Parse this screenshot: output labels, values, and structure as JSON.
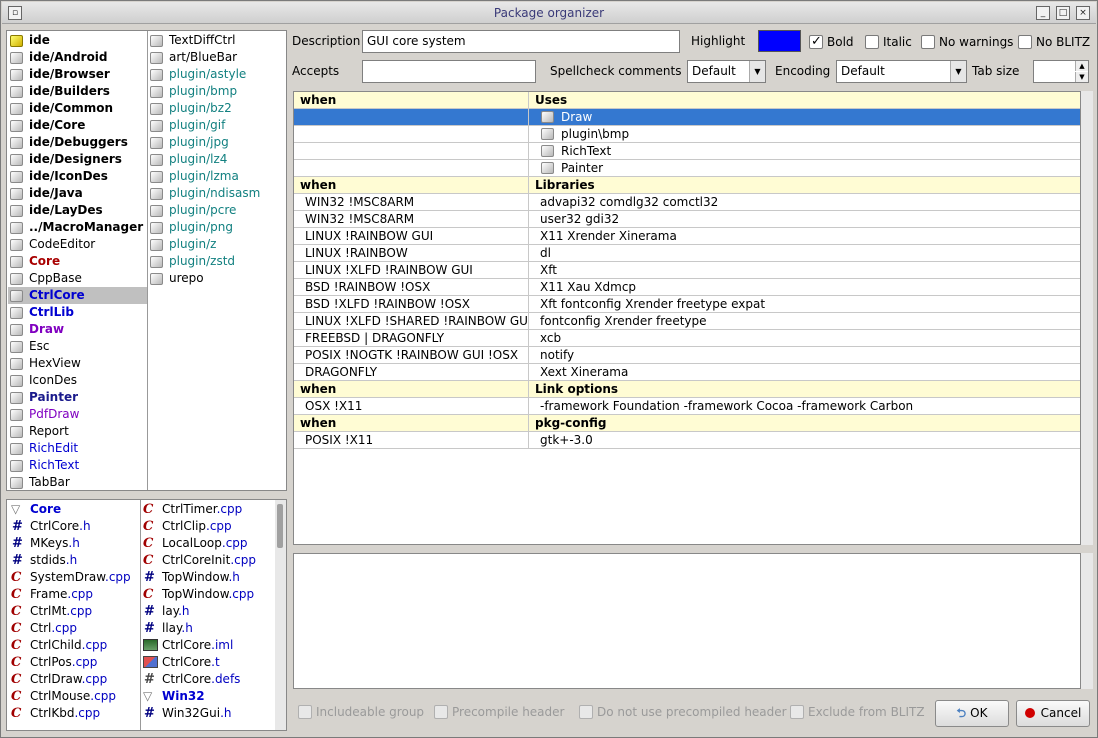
{
  "window": {
    "title": "Package organizer"
  },
  "packages_col1": [
    {
      "label": "ide",
      "cls": "bold",
      "icon": "yellow-package-icon"
    },
    {
      "label": "ide/Android",
      "cls": "bold",
      "icon": "package-icon"
    },
    {
      "label": "ide/Browser",
      "cls": "bold",
      "icon": "package-icon"
    },
    {
      "label": "ide/Builders",
      "cls": "bold",
      "icon": "package-icon"
    },
    {
      "label": "ide/Common",
      "cls": "bold",
      "icon": "package-icon"
    },
    {
      "label": "ide/Core",
      "cls": "bold",
      "icon": "package-icon"
    },
    {
      "label": "ide/Debuggers",
      "cls": "bold",
      "icon": "package-icon"
    },
    {
      "label": "ide/Designers",
      "cls": "bold",
      "icon": "package-icon"
    },
    {
      "label": "ide/IconDes",
      "cls": "bold",
      "icon": "package-icon"
    },
    {
      "label": "ide/Java",
      "cls": "bold",
      "icon": "package-icon"
    },
    {
      "label": "ide/LayDes",
      "cls": "bold",
      "icon": "package-icon"
    },
    {
      "label": "../MacroManager",
      "cls": "bold",
      "icon": "package-icon"
    },
    {
      "label": "CodeEditor",
      "cls": "",
      "icon": "package-icon"
    },
    {
      "label": "Core",
      "cls": "bold red",
      "icon": "package-icon"
    },
    {
      "label": "CppBase",
      "cls": "",
      "icon": "package-icon"
    },
    {
      "label": "CtrlCore",
      "cls": "bold blue sel",
      "icon": "package-icon"
    },
    {
      "label": "CtrlLib",
      "cls": "bold blue",
      "icon": "package-icon"
    },
    {
      "label": "Draw",
      "cls": "bold purple",
      "icon": "package-icon"
    },
    {
      "label": "Esc",
      "cls": "",
      "icon": "package-icon"
    },
    {
      "label": "HexView",
      "cls": "",
      "icon": "package-icon"
    },
    {
      "label": "IconDes",
      "cls": "",
      "icon": "package-icon"
    },
    {
      "label": "Painter",
      "cls": "bold navy",
      "icon": "package-icon"
    },
    {
      "label": "PdfDraw",
      "cls": "purple",
      "icon": "package-icon"
    },
    {
      "label": "Report",
      "cls": "",
      "icon": "package-icon"
    },
    {
      "label": "RichEdit",
      "cls": "blue",
      "icon": "package-icon"
    },
    {
      "label": "RichText",
      "cls": "blue",
      "icon": "package-icon"
    },
    {
      "label": "TabBar",
      "cls": "",
      "icon": "package-icon"
    }
  ],
  "packages_col2": [
    {
      "label": "TextDiffCtrl",
      "cls": ""
    },
    {
      "label": "art/BlueBar",
      "cls": ""
    },
    {
      "label": "plugin/astyle",
      "cls": "teal"
    },
    {
      "label": "plugin/bmp",
      "cls": "teal"
    },
    {
      "label": "plugin/bz2",
      "cls": "teal"
    },
    {
      "label": "plugin/gif",
      "cls": "teal"
    },
    {
      "label": "plugin/jpg",
      "cls": "teal"
    },
    {
      "label": "plugin/lz4",
      "cls": "teal"
    },
    {
      "label": "plugin/lzma",
      "cls": "teal"
    },
    {
      "label": "plugin/ndisasm",
      "cls": "teal"
    },
    {
      "label": "plugin/pcre",
      "cls": "teal"
    },
    {
      "label": "plugin/png",
      "cls": "teal"
    },
    {
      "label": "plugin/z",
      "cls": "teal"
    },
    {
      "label": "plugin/zstd",
      "cls": "teal"
    },
    {
      "label": "urepo",
      "cls": ""
    }
  ],
  "files_col1": [
    {
      "name": "Core",
      "ext": "",
      "kind": "group"
    },
    {
      "name": "CtrlCore",
      "ext": ".h",
      "kind": "header"
    },
    {
      "name": "MKeys",
      "ext": ".h",
      "kind": "header"
    },
    {
      "name": "stdids",
      "ext": ".h",
      "kind": "header"
    },
    {
      "name": "SystemDraw",
      "ext": ".cpp",
      "kind": "cpp"
    },
    {
      "name": "Frame",
      "ext": ".cpp",
      "kind": "cpp"
    },
    {
      "name": "CtrlMt",
      "ext": ".cpp",
      "kind": "cpp"
    },
    {
      "name": "Ctrl",
      "ext": ".cpp",
      "kind": "cpp"
    },
    {
      "name": "CtrlChild",
      "ext": ".cpp",
      "kind": "cpp"
    },
    {
      "name": "CtrlPos",
      "ext": ".cpp",
      "kind": "cpp"
    },
    {
      "name": "CtrlDraw",
      "ext": ".cpp",
      "kind": "cpp"
    },
    {
      "name": "CtrlMouse",
      "ext": ".cpp",
      "kind": "cpp"
    },
    {
      "name": "CtrlKbd",
      "ext": ".cpp",
      "kind": "cpp"
    }
  ],
  "files_col2": [
    {
      "name": "CtrlTimer",
      "ext": ".cpp",
      "kind": "cpp"
    },
    {
      "name": "CtrlClip",
      "ext": ".cpp",
      "kind": "cpp"
    },
    {
      "name": "LocalLoop",
      "ext": ".cpp",
      "kind": "cpp"
    },
    {
      "name": "CtrlCoreInit",
      "ext": ".cpp",
      "kind": "cpp"
    },
    {
      "name": "TopWindow",
      "ext": ".h",
      "kind": "header"
    },
    {
      "name": "TopWindow",
      "ext": ".cpp",
      "kind": "cpp"
    },
    {
      "name": "lay",
      "ext": ".h",
      "kind": "header"
    },
    {
      "name": "llay",
      "ext": ".h",
      "kind": "header"
    },
    {
      "name": "CtrlCore",
      "ext": ".iml",
      "kind": "image"
    },
    {
      "name": "CtrlCore",
      "ext": ".t",
      "kind": "translation"
    },
    {
      "name": "CtrlCore",
      "ext": ".defs",
      "kind": "defs"
    },
    {
      "name": "Win32",
      "ext": "",
      "kind": "group"
    },
    {
      "name": "Win32Gui",
      "ext": ".h",
      "kind": "header"
    }
  ],
  "form": {
    "description_label": "Description",
    "description_value": "GUI core system",
    "highlight_label": "Highlight",
    "highlight_color": "#0000ff",
    "bold_label": "Bold",
    "italic_label": "Italic",
    "nowarn_label": "No warnings",
    "noblitz_label": "No BLITZ",
    "accepts_label": "Accepts",
    "accepts_value": "",
    "spellcheck_label": "Spellcheck comments",
    "spellcheck_value": "Default",
    "encoding_label": "Encoding",
    "encoding_value": "Default",
    "tabsize_label": "Tab size",
    "tabsize_value": ""
  },
  "grid": [
    {
      "type": "header",
      "c1": "when",
      "c2": "Uses"
    },
    {
      "type": "use",
      "c1": "",
      "c2": "Draw",
      "selected": true
    },
    {
      "type": "use",
      "c1": "",
      "c2": "plugin\\bmp"
    },
    {
      "type": "use",
      "c1": "",
      "c2": "RichText"
    },
    {
      "type": "use",
      "c1": "",
      "c2": "Painter"
    },
    {
      "type": "header",
      "c1": "when",
      "c2": "Libraries"
    },
    {
      "type": "row",
      "c1": "WIN32 !MSC8ARM",
      "c2": "advapi32 comdlg32 comctl32"
    },
    {
      "type": "row",
      "c1": "WIN32 !MSC8ARM",
      "c2": "user32 gdi32"
    },
    {
      "type": "row",
      "c1": "LINUX !RAINBOW GUI",
      "c2": "X11 Xrender Xinerama"
    },
    {
      "type": "row",
      "c1": "LINUX  !RAINBOW",
      "c2": "dl"
    },
    {
      "type": "row",
      "c1": "LINUX !XLFD  !RAINBOW GUI",
      "c2": "Xft"
    },
    {
      "type": "row",
      "c1": "BSD !RAINBOW !OSX",
      "c2": "X11  Xau Xdmcp"
    },
    {
      "type": "row",
      "c1": "BSD !XLFD  !RAINBOW !OSX",
      "c2": "Xft fontconfig Xrender freetype expat"
    },
    {
      "type": "row",
      "c1": "LINUX !XLFD !SHARED  !RAINBOW GU",
      "c2": "fontconfig Xrender freetype"
    },
    {
      "type": "row",
      "c1": "FREEBSD |  DRAGONFLY",
      "c2": "xcb"
    },
    {
      "type": "row",
      "c1": "POSIX !NOGTK !RAINBOW GUI !OSX",
      "c2": "notify"
    },
    {
      "type": "row",
      "c1": "DRAGONFLY",
      "c2": "Xext Xinerama"
    },
    {
      "type": "header",
      "c1": "when",
      "c2": "Link options"
    },
    {
      "type": "row",
      "c1": "OSX !X11",
      "c2": "-framework Foundation -framework Cocoa -framework Carbon"
    },
    {
      "type": "header",
      "c1": "when",
      "c2": "pkg-config"
    },
    {
      "type": "row",
      "c1": "POSIX !X11",
      "c2": "gtk+-3.0"
    }
  ],
  "bottom": {
    "includeable": "Includeable group",
    "precompile": "Precompile header",
    "noprecompiled": "Do not use precompiled header",
    "excludeblitz": "Exclude from BLITZ",
    "ok": "OK",
    "cancel": "Cancel"
  },
  "colors": {
    "selection": "#3478d0",
    "header_row": "#fffcd4",
    "window_bg": "#d6d3ce"
  }
}
